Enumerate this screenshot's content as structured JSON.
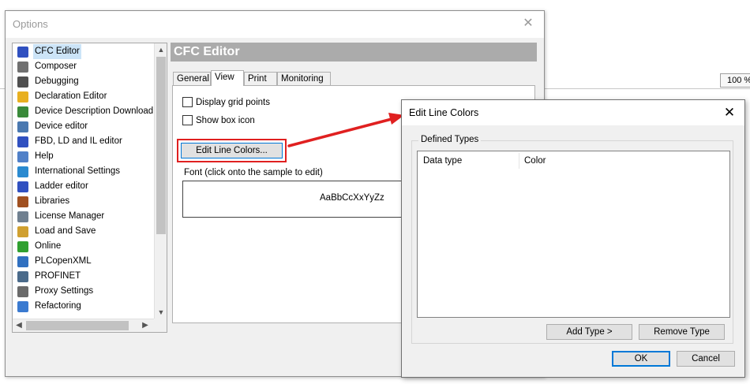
{
  "background": {
    "zoom_text": "100 %"
  },
  "options": {
    "title": "Options",
    "close_glyph": "✕",
    "categories": [
      {
        "label": "CFC Editor",
        "icon": "cfc-editor-icon",
        "color": "#3050c0",
        "selected": true
      },
      {
        "label": "Composer",
        "icon": "composer-icon",
        "color": "#707070"
      },
      {
        "label": "Debugging",
        "icon": "debugging-icon",
        "color": "#505050"
      },
      {
        "label": "Declaration Editor",
        "icon": "declaration-editor-icon",
        "color": "#e8b020"
      },
      {
        "label": "Device Description Download",
        "icon": "device-description-download-icon",
        "color": "#3a8a3a"
      },
      {
        "label": "Device editor",
        "icon": "device-editor-icon",
        "color": "#4a78b0"
      },
      {
        "label": "FBD, LD and IL editor",
        "icon": "fbd-ld-il-editor-icon",
        "color": "#3050c0"
      },
      {
        "label": "Help",
        "icon": "help-icon",
        "color": "#5080c8"
      },
      {
        "label": "International Settings",
        "icon": "international-settings-icon",
        "color": "#2a8ad0"
      },
      {
        "label": "Ladder editor",
        "icon": "ladder-editor-icon",
        "color": "#3050c0"
      },
      {
        "label": "Libraries",
        "icon": "libraries-icon",
        "color": "#a05020"
      },
      {
        "label": "License Manager",
        "icon": "license-manager-icon",
        "color": "#708090"
      },
      {
        "label": "Load and Save",
        "icon": "load-and-save-icon",
        "color": "#d0a030"
      },
      {
        "label": "Online",
        "icon": "online-icon",
        "color": "#30a030"
      },
      {
        "label": "PLCopenXML",
        "icon": "plcopenxml-icon",
        "color": "#3070c0"
      },
      {
        "label": "PROFINET",
        "icon": "profinet-icon",
        "color": "#4a6a8a"
      },
      {
        "label": "Proxy Settings",
        "icon": "proxy-settings-icon",
        "color": "#6a6a6a"
      },
      {
        "label": "Refactoring",
        "icon": "refactoring-icon",
        "color": "#3a7ad0"
      }
    ],
    "panel_title": "CFC Editor",
    "tabs": [
      "General",
      "View",
      "Print",
      "Monitoring"
    ],
    "active_tab": "View",
    "view": {
      "display_grid_points": "Display grid points",
      "show_box_icon": "Show box icon",
      "edit_line_colors_button": "Edit Line Colors...",
      "font_label": "Font (click onto the sample to edit)",
      "font_sample": "AaBbCcXxYyZz"
    }
  },
  "dialog": {
    "title": "Edit Line Colors",
    "close_glyph": "✕",
    "group_label": "Defined Types",
    "columns": [
      "Data type",
      "Color"
    ],
    "add_type": "Add Type >",
    "remove_type": "Remove Type",
    "ok": "OK",
    "cancel": "Cancel"
  },
  "colors": {
    "highlight": "#e02020",
    "selection": "#cce4f7",
    "accent": "#0078d7"
  }
}
